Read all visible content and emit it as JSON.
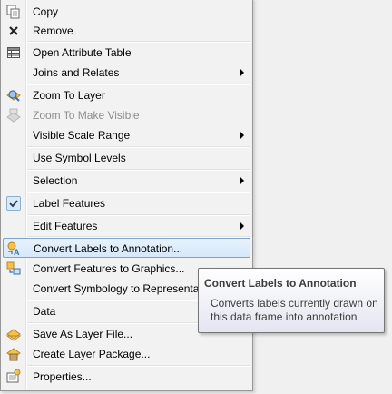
{
  "menu": {
    "items": [
      {
        "label": "Copy",
        "icon": "copy-icon"
      },
      {
        "label": "Remove",
        "icon": "remove-icon"
      },
      {
        "label": "Open Attribute Table",
        "icon": "attribute-table-icon"
      },
      {
        "label": "Joins and Relates",
        "submenu": true
      },
      {
        "label": "Zoom To Layer",
        "icon": "zoom-to-layer-icon"
      },
      {
        "label": "Zoom To Make Visible",
        "icon": "zoom-visible-icon",
        "disabled": true
      },
      {
        "label": "Visible Scale Range",
        "submenu": true
      },
      {
        "label": "Use Symbol Levels"
      },
      {
        "label": "Selection",
        "submenu": true
      },
      {
        "label": "Label Features",
        "icon": "checkmark-icon",
        "checked": true
      },
      {
        "label": "Edit Features",
        "submenu": true
      },
      {
        "label": "Convert Labels to Annotation...",
        "icon": "convert-labels-icon",
        "highlighted": true
      },
      {
        "label": "Convert Features to Graphics...",
        "icon": "convert-features-icon"
      },
      {
        "label": "Convert Symbology to Representation..."
      },
      {
        "label": "Data",
        "submenu": true
      },
      {
        "label": "Save As Layer File...",
        "icon": "layer-file-icon"
      },
      {
        "label": "Create Layer Package...",
        "icon": "layer-package-icon"
      },
      {
        "label": "Properties...",
        "icon": "properties-icon"
      }
    ]
  },
  "tooltip": {
    "title": "Convert Labels to Annotation",
    "body": "Converts labels currently drawn on this data frame into annotation"
  },
  "colors": {
    "highlight_border": "#7da2ce",
    "highlight_fill": "#d6e8fa",
    "disabled_text": "#8d8d8d"
  }
}
